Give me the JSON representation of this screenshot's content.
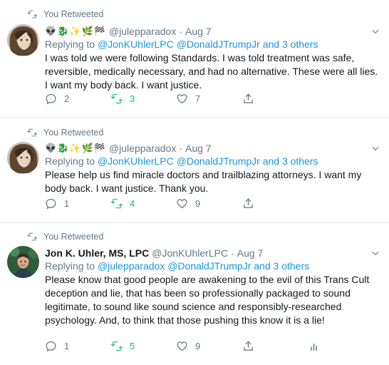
{
  "tweets": [
    {
      "retweet_label": "You Retweeted",
      "author_name": "",
      "author_emoji": "👽🐉✨🌿🏁",
      "handle": "@julepparadox",
      "date": "Aug 7",
      "replying_prefix": "Replying to",
      "replying_links": "@JonKUhlerLPC @DonaldJTrumpJr and 3 others",
      "text": "I was told we were following Standards. I was told treatment was safe, reversible, medically necessary, and had no alternative. These were all lies. I want my body back. I want justice.",
      "replies": "2",
      "retweets": "3",
      "likes": "7"
    },
    {
      "retweet_label": "You Retweeted",
      "author_name": "",
      "author_emoji": "👽🐉✨🌿🏁",
      "handle": "@julepparadox",
      "date": "Aug 7",
      "replying_prefix": "Replying to",
      "replying_links": "@JonKUhlerLPC @DonaldJTrumpJr and 3 others",
      "text": "Please help us find miracle doctors and trailblazing attorneys. I want my body back. I want justice. Thank you.",
      "replies": "1",
      "retweets": "4",
      "likes": "9"
    },
    {
      "retweet_label": "You Retweeted",
      "author_name": "Jon K. Uhler, MS, LPC",
      "author_emoji": "",
      "handle": "@JonKUhlerLPC",
      "date": "Aug 7",
      "replying_prefix": "Replying to",
      "replying_links": "@julepparadox @DonaldJTrumpJr and 3 others",
      "text": "Please know that good people are awakening to the evil of this Trans Cult deception and lie, that has been so professionally packaged to sound legitimate, to sound like sound science and responsibly-researched psychology. And, to think that those pushing this know it is a lie!",
      "replies": "1",
      "retweets": "5",
      "likes": "9"
    }
  ],
  "colors": {
    "link": "#1b95e0",
    "muted": "#657786",
    "retweet_active": "#17bf63",
    "divider": "#e6ecf0"
  },
  "icons": [
    "retweet-icon",
    "chevron-down-icon",
    "reply-icon",
    "like-icon",
    "share-icon",
    "analytics-icon"
  ]
}
